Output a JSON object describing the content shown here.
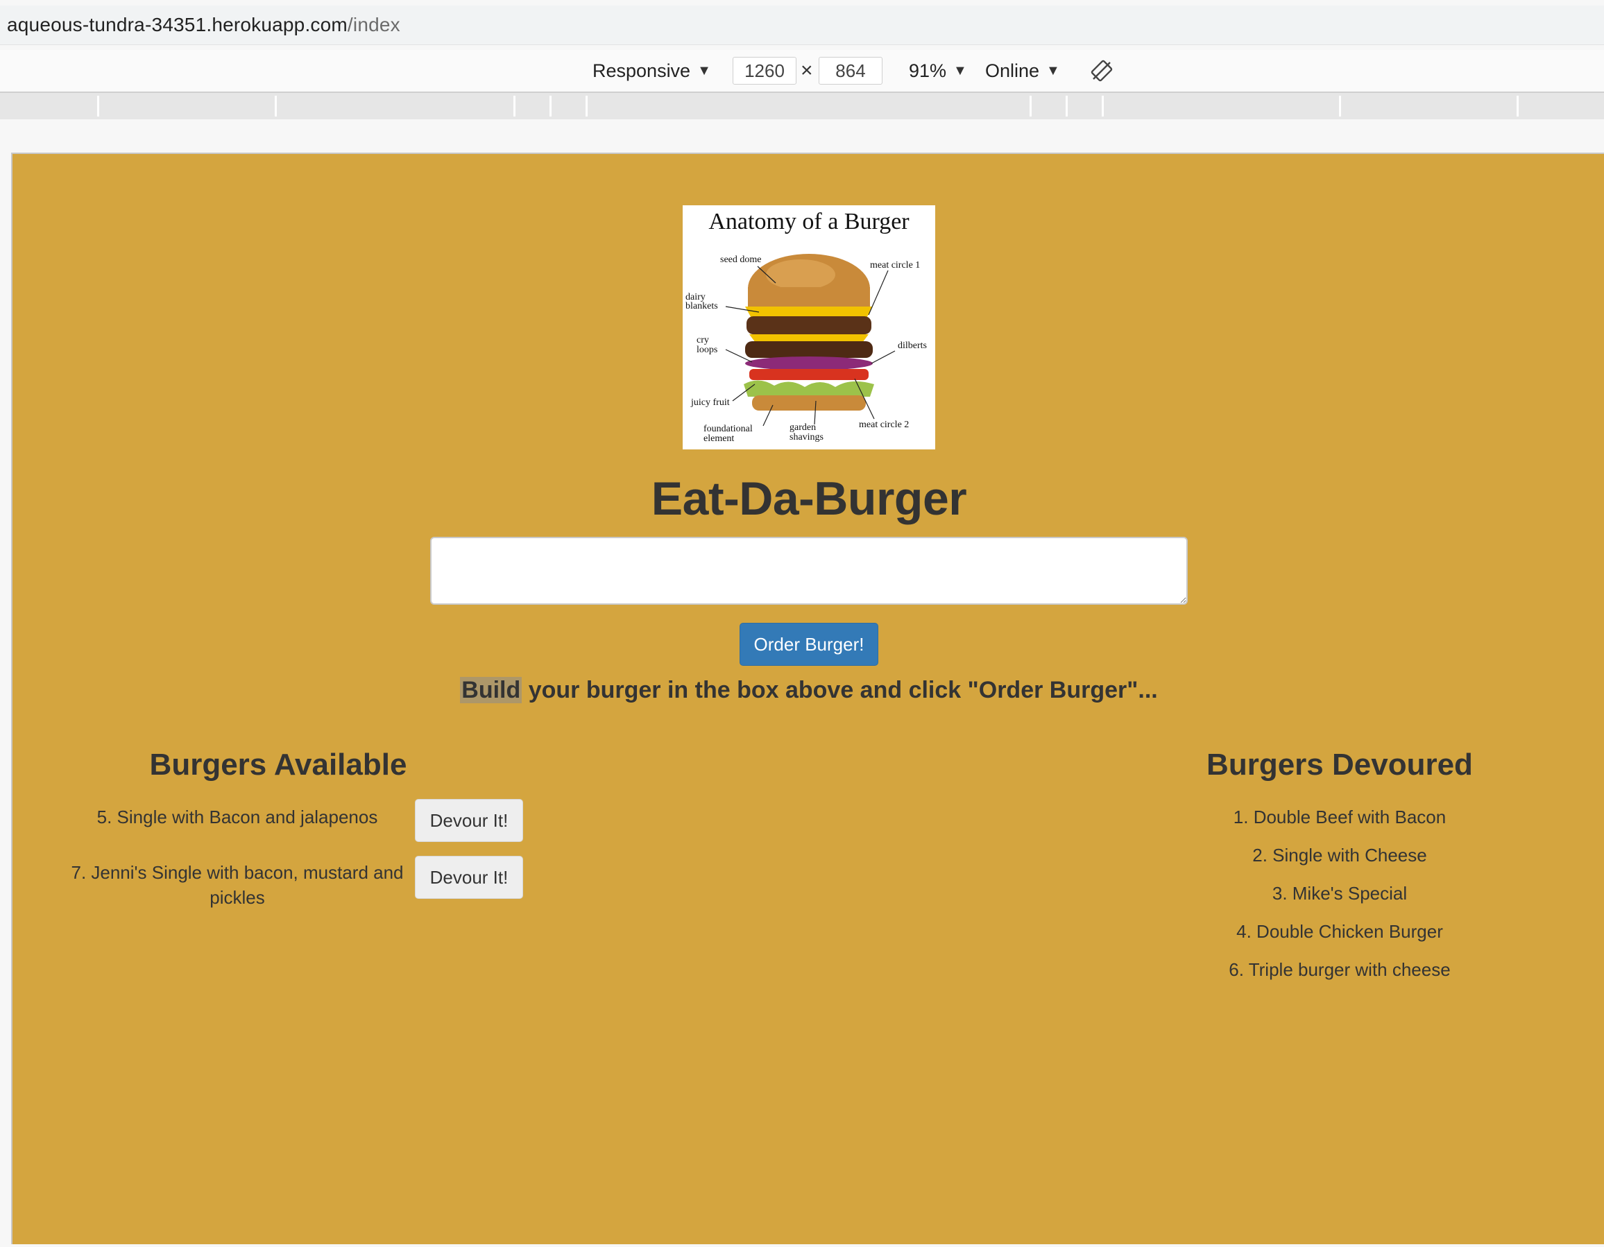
{
  "browser": {
    "url_host": "aqueous-tundra-34351.herokuapp.com",
    "url_path": "/index"
  },
  "devtools": {
    "device": "Responsive",
    "width": "1260",
    "times": "×",
    "height": "864",
    "zoom": "91%",
    "network": "Online",
    "caret": "▼"
  },
  "page": {
    "logo_alt": "Anatomy of a Burger",
    "logo_text": {
      "title": "Anatomy of a Burger",
      "labels": [
        "seed dome",
        "meat circle 1",
        "dairy",
        "blankets",
        "cry",
        "loops",
        "dilberts",
        "juicy fruit",
        "foundational",
        "element",
        "garden",
        "shavings",
        "meat circle 2"
      ]
    },
    "title": "Eat-Da-Burger",
    "input_value": "",
    "order_button": "Order Burger!",
    "instructions_highlight": "Build",
    "instructions_rest": " your burger in the box above and click \"Order Burger\"...",
    "available": {
      "heading": "Burgers Available",
      "items": [
        {
          "text": "5. Single with Bacon and jalapenos",
          "button": "Devour It!"
        },
        {
          "text": "7. Jenni's Single with bacon, mustard and pickles",
          "button": "Devour It!"
        }
      ]
    },
    "devoured": {
      "heading": "Burgers Devoured",
      "items": [
        "1. Double Beef with Bacon",
        "2. Single with Cheese",
        "3. Mike's Special",
        "4. Double Chicken Burger",
        "6. Triple burger with cheese"
      ]
    },
    "colors": {
      "background": "#d4a53f",
      "primary_button": "#337ab7"
    }
  }
}
